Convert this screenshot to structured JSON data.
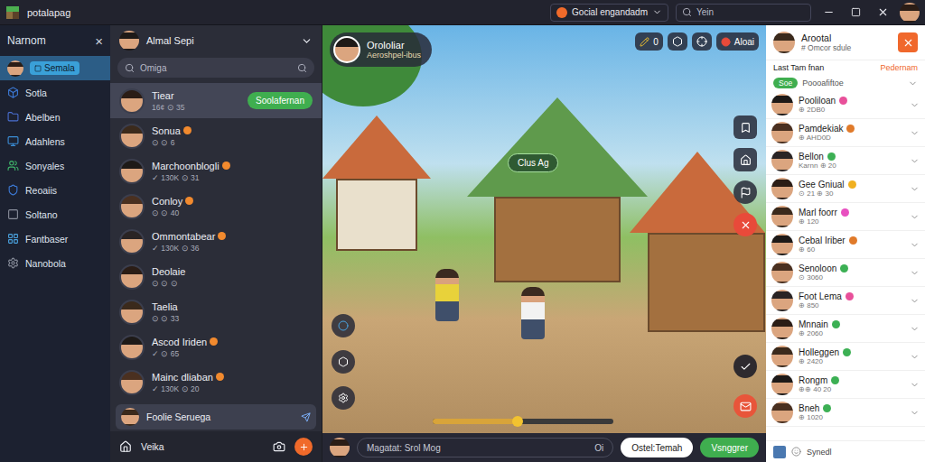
{
  "titlebar": {
    "app": "potalapag",
    "workspace": "Gocial engandadm",
    "search": "Yein"
  },
  "sidebar": {
    "title": "Narnom",
    "close": "×",
    "items": [
      {
        "label": "Semala",
        "selected": true,
        "color": "#3aa0d8"
      },
      {
        "label": "Sotla",
        "selected": false,
        "color": "#3d7bd9"
      },
      {
        "label": "Abelben",
        "selected": false,
        "color": "#4a6fd1"
      },
      {
        "label": "Adahlens",
        "selected": false,
        "color": "#3b8fd8"
      },
      {
        "label": "Sonyales",
        "selected": false,
        "color": "#3fb56a"
      },
      {
        "label": "Reoaiis",
        "selected": false,
        "color": "#3d7bd9"
      },
      {
        "label": "Soltano",
        "selected": false,
        "color": "#8a8f9c"
      },
      {
        "label": "Fantbaser",
        "selected": false,
        "color": "#4aa3e0"
      },
      {
        "label": "Nanobola",
        "selected": false,
        "color": "#8a8f9c"
      }
    ]
  },
  "chats": {
    "header": "Almal Sepi",
    "search": "Omiga",
    "items": [
      {
        "name": "Tiear",
        "sub": "16¢ ⊙ 35",
        "tag": "Soolafernan",
        "selected": true,
        "emoji": false
      },
      {
        "name": "Sonua",
        "sub": "⊙ ⊙ 6",
        "tag": "",
        "selected": false,
        "emoji": true
      },
      {
        "name": "Marchoonblogli",
        "sub": "✓ 130K ⊙ 31",
        "tag": "",
        "selected": false,
        "emoji": true
      },
      {
        "name": "Conloy",
        "sub": "⊙ ⊙ 40",
        "tag": "",
        "selected": false,
        "emoji": true
      },
      {
        "name": "Ommontabear",
        "sub": "✓ 130K ⊙ 36",
        "tag": "",
        "selected": false,
        "emoji": true
      },
      {
        "name": "Deolaie",
        "sub": "⊙ ⊙ ⊙",
        "tag": "",
        "selected": false,
        "emoji": false
      },
      {
        "name": "Taelia",
        "sub": "⊙ ⊙ 33",
        "tag": "",
        "selected": false,
        "emoji": false
      },
      {
        "name": "Ascod Iriden",
        "sub": "✓ ⊙ 65",
        "tag": "",
        "selected": false,
        "emoji": true
      },
      {
        "name": "Mainc dliaban",
        "sub": "✓ 130K ⊙ 20",
        "tag": "",
        "selected": false,
        "emoji": true
      }
    ],
    "footer_item": "Foolie Seruega",
    "bottom": "Veika"
  },
  "game": {
    "player": {
      "name": "Orololiar",
      "status": "Aeroshpel-ibus"
    },
    "count": "0",
    "alert": "Aloai",
    "bubble": "Clus Ag",
    "progress": {
      "level": 0.47
    },
    "chat": {
      "placeholder": "Magatat: Srol Mog",
      "hint": "Oi",
      "secondary": "Ostel:Temah",
      "primary": "Vsnggrer"
    }
  },
  "contacts": {
    "title": "Arootal",
    "subtitle": "# Omcor sdule",
    "section": "Last Tam fnan",
    "action": "Pedernam",
    "pinned": {
      "tag": "Soe",
      "name": "Poooafiftoe"
    },
    "items": [
      {
        "name": "Pooliloan",
        "sub": "⊕ 2DB0",
        "color": "#e8509a"
      },
      {
        "name": "Pamdekiak",
        "sub": "⊕ AHD0D",
        "color": "#e07a2a"
      },
      {
        "name": "Bellon",
        "sub": "Karnn ⊕ 20",
        "color": "#3cb054"
      },
      {
        "name": "Gee Gniual",
        "sub": "⊙ 21 ⊕ 30",
        "color": "#f0b020"
      },
      {
        "name": "Marl foorr",
        "sub": "⊕ 120",
        "color": "#e850c0"
      },
      {
        "name": "Cebal Iriber",
        "sub": "⊕ 60",
        "color": "#e07a2a"
      },
      {
        "name": "Senoloon",
        "sub": "⊙ 3060",
        "color": "#3cb054"
      },
      {
        "name": "Foot Lema",
        "sub": "⊕ 850",
        "color": "#e8509a"
      },
      {
        "name": "Mnnain",
        "sub": "⊕ 2060",
        "color": "#3cb054"
      },
      {
        "name": "Holleggen",
        "sub": "⊕ 2420",
        "color": "#3cb054"
      },
      {
        "name": "Rongm",
        "sub": "⊕⊕ 40 20",
        "color": "#3cb054"
      },
      {
        "name": "Bneh",
        "sub": "⊕ 1020",
        "color": "#3cb054"
      }
    ],
    "footer": "Synedl"
  }
}
